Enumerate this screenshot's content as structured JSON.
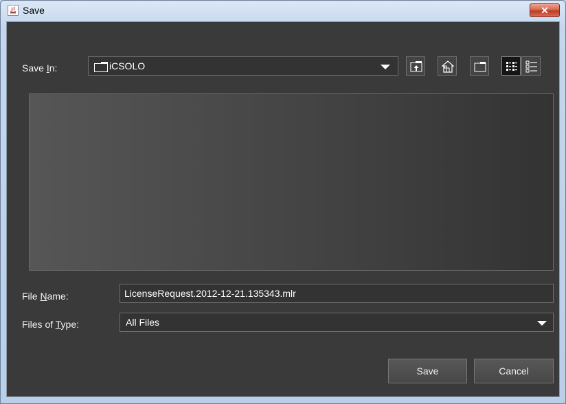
{
  "window": {
    "title": "Save",
    "close_symbol": "✕"
  },
  "save_in": {
    "label_pre": "Save ",
    "label_mnemonic": "I",
    "label_post": "n:",
    "selected": "iCSOLO",
    "toolbar": [
      {
        "name": "up-one-level-icon"
      },
      {
        "name": "home-icon"
      },
      {
        "name": "new-folder-icon"
      },
      {
        "name": "list-view-icon",
        "active": true
      },
      {
        "name": "details-view-icon"
      }
    ]
  },
  "file_name": {
    "label_pre": "File ",
    "label_mnemonic": "N",
    "label_post": "ame:",
    "value": "LicenseRequest.2012-12-21.135343.mlr"
  },
  "file_type": {
    "label_pre": "Files of ",
    "label_mnemonic": "T",
    "label_post": "ype:",
    "selected": "All Files"
  },
  "buttons": {
    "save": "Save",
    "cancel": "Cancel"
  },
  "colors": {
    "dialog_bg": "#3a3a3a",
    "title_bar": "#c4d7ee",
    "close_button": "#c0391f"
  }
}
